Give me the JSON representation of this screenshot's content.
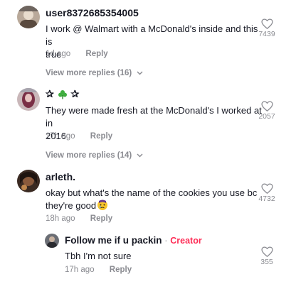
{
  "comments": [
    {
      "username": "user8372685354005",
      "text_line1": "I work @ Walmart with a McDonald's inside and this is",
      "text_line2": "true",
      "time": "1d ago",
      "reply": "Reply",
      "likes": "7439",
      "view_more": "View more replies (16)"
    },
    {
      "username": "✰ ✰",
      "username_icon": "shamrock-icon",
      "text_line1": "They were made fresh at the McDonald's I worked at in",
      "text_line2": "2016",
      "time": "17h ago",
      "reply": "Reply",
      "likes": "2057",
      "view_more": "View more replies (14)"
    },
    {
      "username": "arleth.",
      "text_line1": "okay but what's the name of the cookies you use bc",
      "text_line2": "they're good",
      "text_emoji": "crying-face-emoji",
      "time": "18h ago",
      "reply": "Reply",
      "likes": "4732"
    }
  ],
  "reply": {
    "username": "Follow me if u packin",
    "separator": "·",
    "badge": "Creator",
    "text": "Tbh I'm not sure",
    "time": "17h ago",
    "reply": "Reply",
    "likes": "355"
  },
  "colors": {
    "text": "#161823",
    "muted": "#8a8b91",
    "creator": "#fe2c55"
  }
}
